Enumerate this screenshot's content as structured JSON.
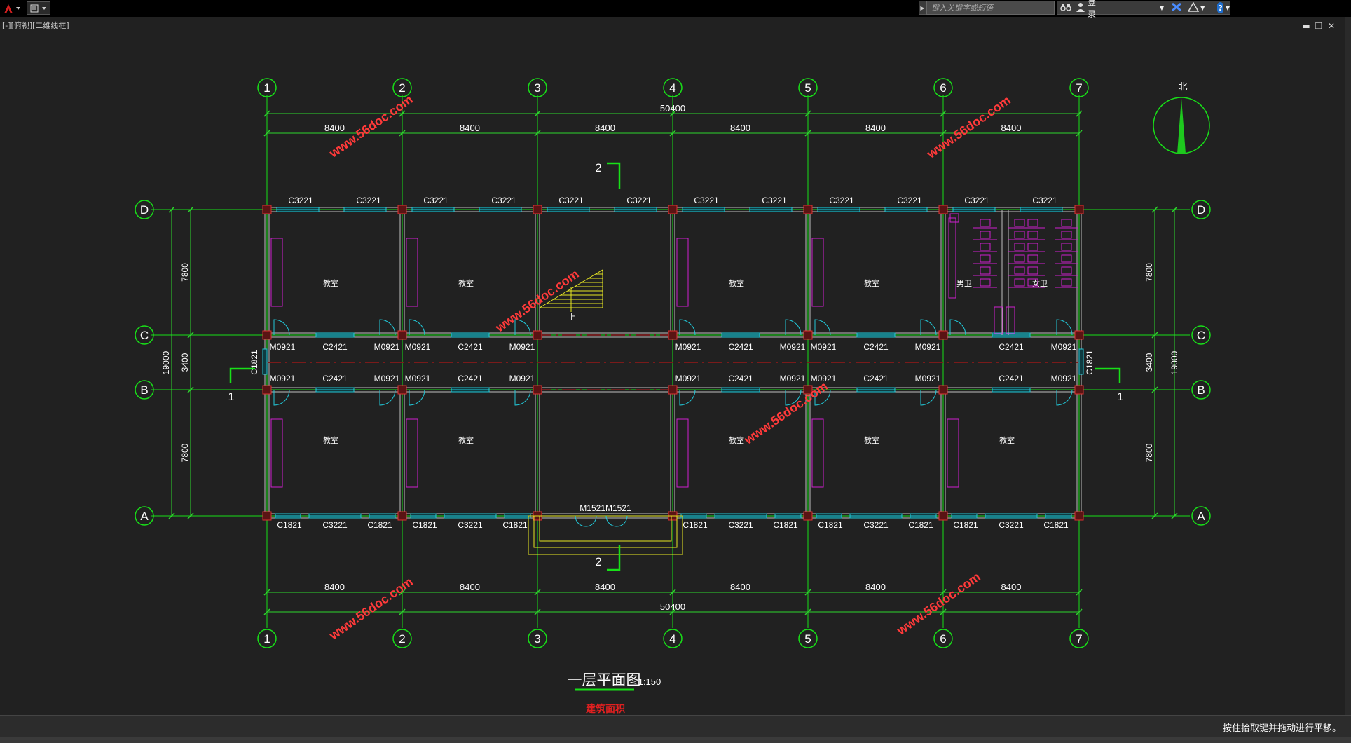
{
  "titlebar": {
    "search_placeholder": "键入关键字或短语",
    "login_label": "登录",
    "help_label": "?"
  },
  "viewport": {
    "label": "[-][俯视][二维线框]"
  },
  "window_controls": {
    "minimize": "▬",
    "restore": "❐",
    "close": "✕"
  },
  "drawing": {
    "axes_x": [
      "1",
      "2",
      "3",
      "4",
      "5",
      "6",
      "7"
    ],
    "axes_y": [
      "D",
      "C",
      "B",
      "A"
    ],
    "dim_bay": "8400",
    "dim_total": "50400",
    "dim_depth": "7800",
    "dim_corridor": "3400",
    "dim_width_total": "19000",
    "north_label": "北",
    "title": "一层平面图",
    "scale": "1:150",
    "area_note": "建筑面积",
    "watermark": "www.56doc.com",
    "section_2_label": "2",
    "section_1_label": "1",
    "stair_label": "上",
    "room_classroom": "教室",
    "room_male_wc": "男卫",
    "room_female_wc": "女卫",
    "win_top": "C3221",
    "win_corridor": "C2421",
    "win_bottom_small": "C1821",
    "win_bottom_big": "C3221",
    "win_end": "C1821",
    "door_classroom": "M0921",
    "door_entrance": "M1521M1521",
    "colors": {
      "axis": "#18e018",
      "dim": "#2dd62d",
      "wall": "#c0c0c0",
      "window": "#22c8d8",
      "column": "#e03030",
      "furniture": "#d01fd0",
      "stair": "#e6e622",
      "watermark": "#ff3a3a",
      "text": "#ffffff"
    }
  },
  "status": {
    "text": "按住拾取键并拖动进行平移。"
  }
}
